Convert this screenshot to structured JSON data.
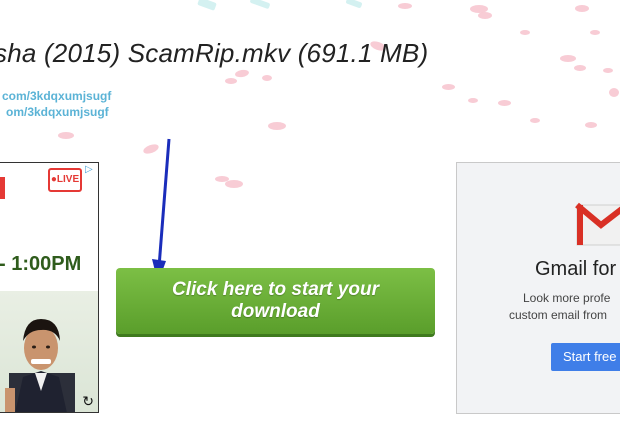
{
  "file": {
    "title": "sha (2015) ScamRip.mkv (691.1 MB)",
    "link1": "com/3kdqxumjsugf",
    "link2": "om/3kdqxumjsugf"
  },
  "left_ad": {
    "live_label": "LIVE",
    "time_text": "- 1:00PM"
  },
  "download": {
    "button_label": "Click here to start your download"
  },
  "right_ad": {
    "heading": "Gmail for",
    "sub_line1": "Look more profe",
    "sub_line2": "custom email from",
    "cta_label": "Start free"
  },
  "colors": {
    "download_green": "#6aae36",
    "link_blue": "#5bb3d6",
    "live_red": "#e53935",
    "cta_blue": "#3f7ee8",
    "arrow_blue": "#1a2dbb"
  },
  "icons": [
    "ad-choices-icon",
    "refresh-icon",
    "gmail-logo-icon",
    "down-arrow-icon"
  ]
}
